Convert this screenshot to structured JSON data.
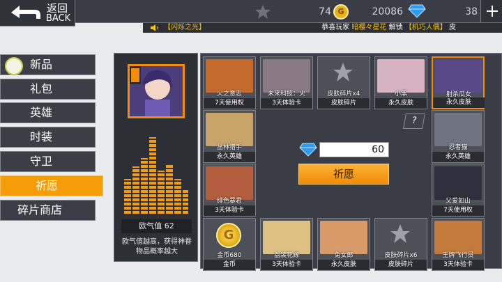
{
  "back": {
    "label_cn": "返回",
    "label_en": "BACK"
  },
  "resources": {
    "stars": "74",
    "gold": "20086",
    "diamonds": "38"
  },
  "marquee": {
    "left": "【闪烁之光】",
    "right_prefix": "恭喜玩家",
    "right_player": "暗樱々星花",
    "right_mid": "解锁",
    "right_item": "【机巧人偶】",
    "right_suffix": "皮"
  },
  "categories": [
    "新品",
    "礼包",
    "英雄",
    "时装",
    "守卫",
    "祈愿",
    "碎片商店"
  ],
  "active_category": "祈愿",
  "luck": {
    "label": "欧气值 62",
    "value": 62
  },
  "description": "欧气值越高，获得神眷物品概率越大",
  "cost": "60",
  "wish_button": "祈愿",
  "help_button": "?",
  "items": [
    {
      "name": "火之意志",
      "type": "7天使用权"
    },
    {
      "name": "未来科技：火",
      "type": "3天体验卡"
    },
    {
      "name": "皮肤碎片x4",
      "type": "皮肤碎片"
    },
    {
      "name": "小黑",
      "type": "永久皮肤"
    },
    {
      "name": "射杀瓜女",
      "type": "永久皮肤"
    },
    {
      "name": "丛林猎手",
      "type": "永久英雄"
    },
    {
      "name": "忍者猫",
      "type": "永久英雄"
    },
    {
      "name": "绯色暴君",
      "type": "3天体验卡"
    },
    {
      "name": "父爱如山",
      "type": "7天使用权"
    },
    {
      "name": "金币680",
      "type": "金币"
    },
    {
      "name": "嚣装花嫁",
      "type": "3天体验卡"
    },
    {
      "name": "兔女郎",
      "type": "永久皮肤"
    },
    {
      "name": "皮肤碎片x6",
      "type": "皮肤碎片"
    },
    {
      "name": "王牌飞行员",
      "type": "3天体验卡"
    }
  ],
  "coin_glyph": "G",
  "colors": {
    "accent": "#f59c07",
    "panel": "#3b3e46",
    "highlight": "#f28c0a",
    "marquee_yellow": "#f2c31b"
  }
}
